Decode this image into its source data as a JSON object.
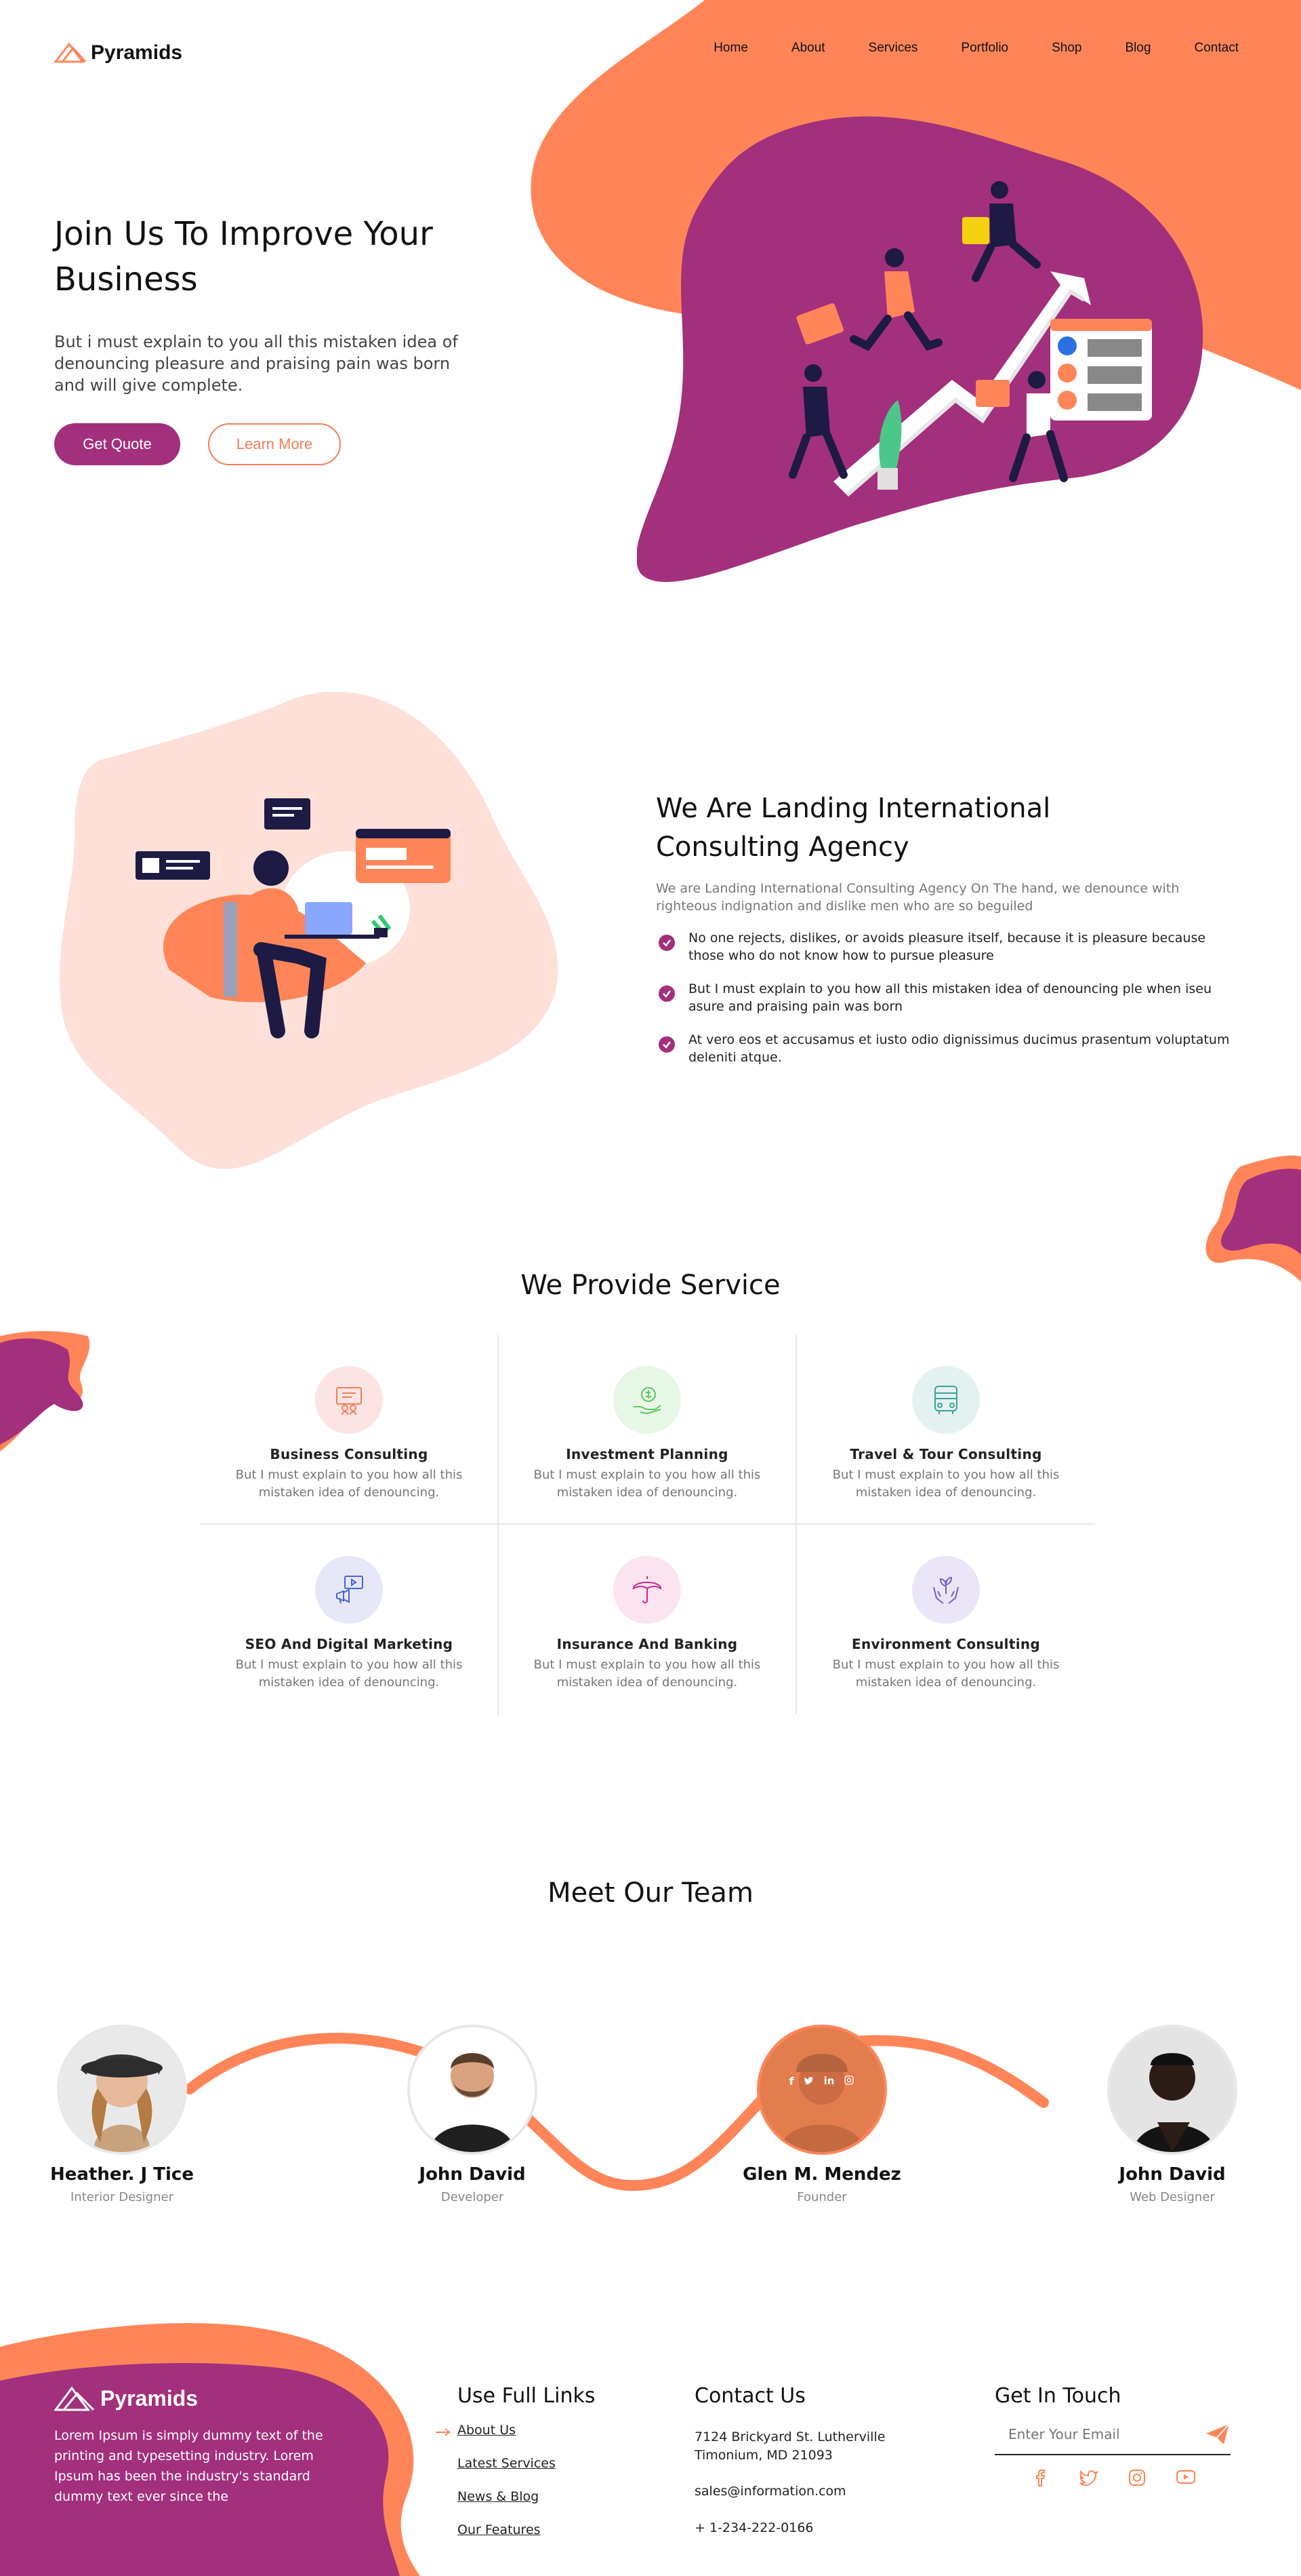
{
  "brand": {
    "name": "Pyramids"
  },
  "nav": {
    "items": [
      "Home",
      "About",
      "Services",
      "Portfolio",
      "Shop",
      "Blog",
      "Contact"
    ]
  },
  "hero": {
    "title": "Join Us To Improve Your Business",
    "text": "But i must explain to you all this mistaken idea of denouncing pleasure and praising pain was born and will give complete.",
    "primary_button": "Get Quote",
    "secondary_button": "Learn More"
  },
  "about": {
    "title": "We Are Landing International Consulting Agency",
    "subtitle": "We are Landing International Consulting Agency On The hand, we denounce with righteous indignation and dislike men who are so beguiled",
    "points": [
      "No one rejects, dislikes, or avoids pleasure itself, because it is pleasure because those who do not know how to pursue pleasure",
      "But I must explain to you how all this mistaken idea of denouncing ple when iseu asure and praising pain was born",
      "At vero eos et accusamus et iusto odio dignissimus ducimus prasentum voluptatum deleniti atque."
    ]
  },
  "services": {
    "title": "We Provide Service",
    "items": [
      {
        "title": "Business Consulting",
        "text": "But I must explain to you how all this mistaken idea of denouncing.",
        "icon": "business-icon",
        "bg": "#fde4e4",
        "stroke": "#f27f56"
      },
      {
        "title": "Investment Planning",
        "text": "But I must explain to you how all this mistaken idea of denouncing.",
        "icon": "investment-icon",
        "bg": "#e6f7e6",
        "stroke": "#5cc65c"
      },
      {
        "title": "Travel & Tour Consulting",
        "text": "But I must explain to you how all this mistaken idea of denouncing.",
        "icon": "bus-icon",
        "bg": "#e3f2f0",
        "stroke": "#3aa39a"
      },
      {
        "title": "SEO And Digital Marketing",
        "text": "But I must explain to you how all this mistaken idea of denouncing.",
        "icon": "marketing-icon",
        "bg": "#e6e8f7",
        "stroke": "#4a63d6"
      },
      {
        "title": "Insurance And Banking",
        "text": "But I must explain to you how all this mistaken idea of denouncing.",
        "icon": "umbrella-icon",
        "bg": "#fbe3f0",
        "stroke": "#c7288a"
      },
      {
        "title": "Environment Consulting",
        "text": "But I must explain to you how all this mistaken idea of denouncing.",
        "icon": "plant-hands-icon",
        "bg": "#ebe6f7",
        "stroke": "#7a5ad0"
      }
    ]
  },
  "team": {
    "title": "Meet Our Team",
    "members": [
      {
        "name": "Heather. J Tice",
        "role": "Interior Designer"
      },
      {
        "name": "John David",
        "role": "Developer"
      },
      {
        "name": "Glen M. Mendez",
        "role": "Founder"
      },
      {
        "name": "John David",
        "role": "Web Designer"
      }
    ]
  },
  "footer": {
    "about_text": "Lorem Ipsum is simply dummy text of the printing and typesetting industry. Lorem Ipsum has been the industry's standard dummy text ever since the",
    "links_title": "Use Full Links",
    "links": [
      "About Us",
      "Latest Services",
      "News & Blog",
      "Our Features"
    ],
    "contact_title": "Contact Us",
    "address": "7124 Brickyard St. Lutherville Timonium, MD 21093",
    "email": "sales@information.com",
    "phone": "+ 1-234-222-0166",
    "touch_title": "Get In Touch",
    "email_placeholder": "Enter Your Email",
    "social": [
      "facebook-icon",
      "twitter-icon",
      "instagram-icon",
      "youtube-icon"
    ]
  },
  "colors": {
    "accent_orange": "#ff8559",
    "accent_purple": "#a3307c",
    "light_peach": "#fee0d8"
  }
}
